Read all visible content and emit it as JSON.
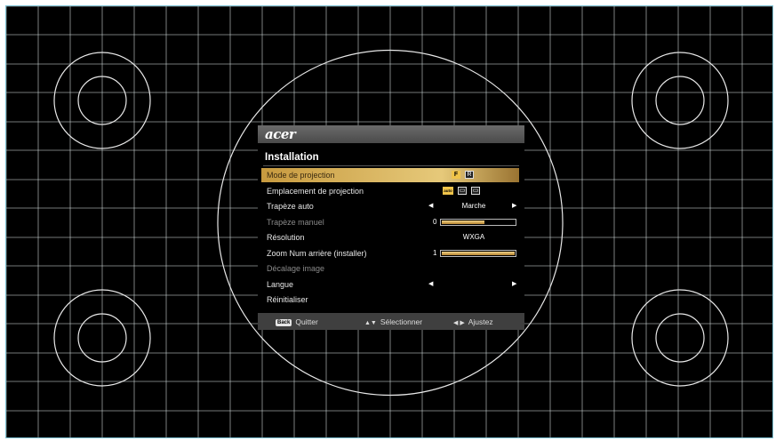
{
  "osd": {
    "brand": "acer",
    "menu_title": "Installation",
    "rows": [
      {
        "label": "Mode de projection",
        "type": "icons",
        "icons": [
          {
            "name": "front-projection-icon",
            "glyph": "F",
            "active": true
          },
          {
            "name": "rear-projection-icon",
            "glyph": "R",
            "active": false
          }
        ]
      },
      {
        "label": "Emplacement de projection",
        "type": "icons",
        "icons": [
          {
            "name": "auto-location-icon",
            "glyph": "auto",
            "active": true
          },
          {
            "name": "desktop-location-icon",
            "glyph": "▭",
            "active": false
          },
          {
            "name": "ceiling-location-icon",
            "glyph": "▭",
            "active": false
          }
        ]
      },
      {
        "label": "Trapèze auto",
        "type": "select",
        "value": "Marche"
      },
      {
        "label": "Trapèze manuel",
        "type": "slider",
        "value": "0",
        "level": 0.6,
        "disabled": true
      },
      {
        "label": "Résolution",
        "type": "text",
        "value": "WXGA"
      },
      {
        "label": "Zoom Num arrière (installer)",
        "type": "slider",
        "value": "1",
        "level": 1.0
      },
      {
        "label": "Décalage image",
        "type": "none",
        "disabled": true
      },
      {
        "label": "Langue",
        "type": "select",
        "value": ""
      },
      {
        "label": "Réinitialiser",
        "type": "none"
      }
    ],
    "footer": {
      "back_key": "Back",
      "quit_label": "Quitter",
      "select_label": "Sélectionner",
      "adjust_label": "Ajustez"
    }
  },
  "colors": {
    "grid_line": "#cfd8d8",
    "selection": "#d7b25e",
    "screen_border": "#7fc4d6"
  }
}
